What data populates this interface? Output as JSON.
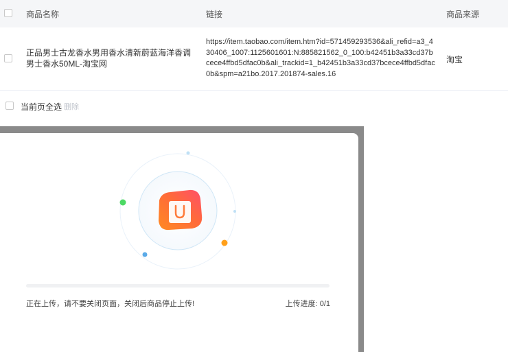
{
  "table": {
    "columns": [
      "商品名称",
      "链接",
      "商品来源"
    ],
    "rows": [
      {
        "name": "正品男士古龙香水男用香水清新蔚蓝海洋香调男士香水50ML-淘宝网",
        "link": "https://item.taobao.com/item.htm?id=571459293536&ali_refid=a3_430406_1007:1125601601:N:885821562_0_100:b42451b3a33cd37bcece4ffbd5dfac0b&ali_trackid=1_b42451b3a33cd37bcece4ffbd5dfac0b&spm=a21bo.2017.201874-sales.16",
        "source": "淘宝",
        "checked": false
      }
    ]
  },
  "footer": {
    "select_all_label": "当前页全选",
    "delete_label": "删除"
  },
  "upload_modal": {
    "status_text": "正在上传，请不要关闭页面，关闭后商品停止上传!",
    "progress_label": "上传进度:",
    "progress_current": "0",
    "progress_total": "1",
    "progress_fraction": 0,
    "icon": "shopping-bag-icon",
    "colors": {
      "icon_gradient_start": "#ff5a6a",
      "icon_gradient_end": "#ffae2e",
      "dot_green": "#4cd964",
      "dot_blue": "#5aaae8",
      "dot_orange": "#ff9f1a",
      "ring": "#d6eaf8"
    }
  }
}
